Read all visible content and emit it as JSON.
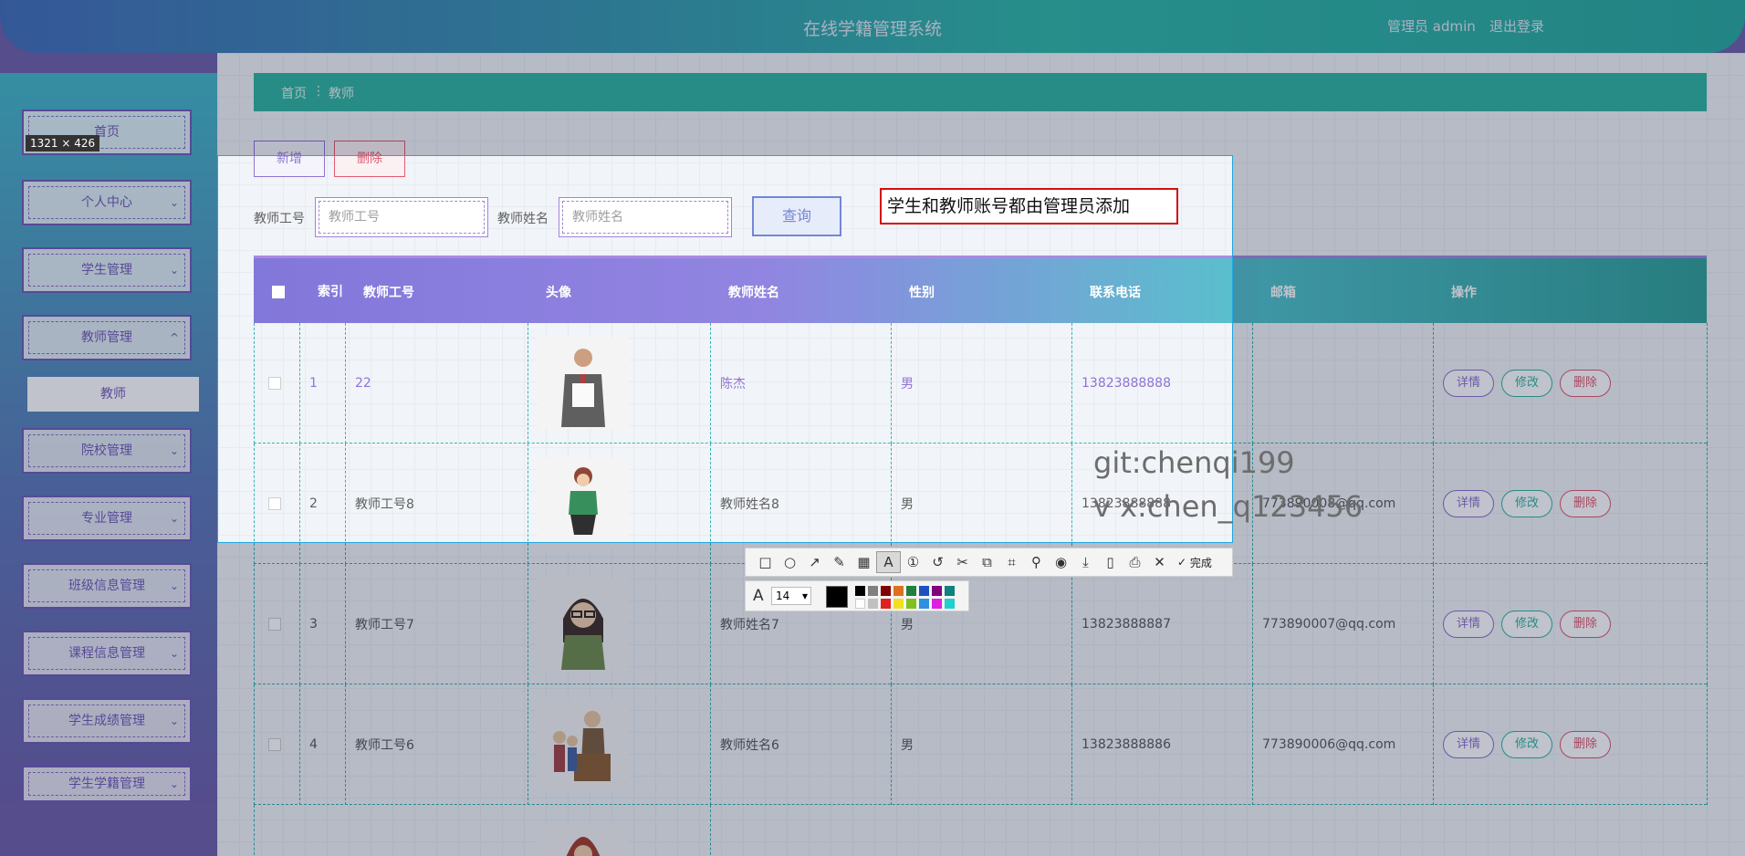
{
  "header": {
    "title": "在线学籍管理系统",
    "user": "管理员 admin",
    "logout": "退出登录"
  },
  "sidebar": {
    "items": [
      {
        "label": "首页"
      },
      {
        "label": "个人中心"
      },
      {
        "label": "学生管理"
      },
      {
        "label": "教师管理"
      },
      {
        "label": "院校管理"
      },
      {
        "label": "专业管理"
      },
      {
        "label": "班级信息管理"
      },
      {
        "label": "课程信息管理"
      },
      {
        "label": "学生成绩管理"
      },
      {
        "label": "学生学籍管理"
      }
    ],
    "sub_active": "教师"
  },
  "breadcrumb": {
    "home": "首页",
    "sep": "⋮",
    "current": "教师"
  },
  "toolbar": {
    "add": "新增",
    "delete": "删除"
  },
  "search": {
    "id_label": "教师工号",
    "id_placeholder": "教师工号",
    "name_label": "教师姓名",
    "name_placeholder": "教师姓名",
    "query": "查询"
  },
  "table": {
    "headers": [
      "索引",
      "教师工号",
      "头像",
      "教师姓名",
      "性别",
      "联系电话",
      "邮箱",
      "操作"
    ],
    "rows": [
      {
        "index": "1",
        "id": "22",
        "name": "陈杰",
        "gender": "男",
        "phone": "13823888888",
        "email": ""
      },
      {
        "index": "2",
        "id": "教师工号8",
        "name": "教师姓名8",
        "gender": "男",
        "phone": "13823888888",
        "email": "773890008@qq.com"
      },
      {
        "index": "3",
        "id": "教师工号7",
        "name": "教师姓名7",
        "gender": "男",
        "phone": "13823888887",
        "email": "773890007@qq.com"
      },
      {
        "index": "4",
        "id": "教师工号6",
        "name": "教师姓名6",
        "gender": "男",
        "phone": "13823888886",
        "email": "773890006@qq.com"
      }
    ],
    "ops": {
      "detail": "详情",
      "edit": "修改",
      "delete": "删除"
    }
  },
  "capture": {
    "size": "1321 × 426",
    "note": "学生和教师账号都由管理员添加",
    "watermark1": "git:chenqi199",
    "watermark2": "v x:chen_q123456",
    "font_size": "14",
    "done": "完成"
  },
  "colors": {
    "accent": "#2bb39e",
    "purple": "#8a6cd0",
    "danger": "#e0526a"
  }
}
